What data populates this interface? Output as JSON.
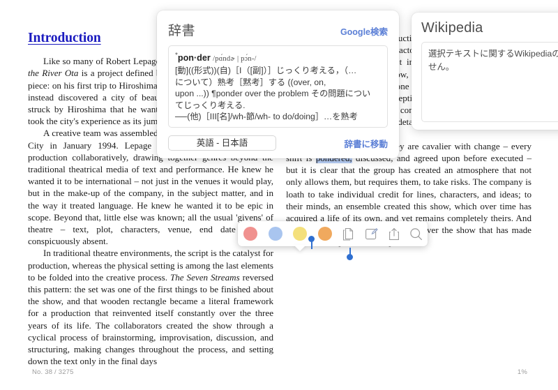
{
  "reader": {
    "chapter_title": "Introduction",
    "left_column": {
      "paragraphs": [
        "Like so many of Robert Lepage's works, The Seven Streams of the River Ota is a project defined by the journey that inspired the piece: on his first trip to Hiroshima, expecting devastation, Lepage instead discovered a city of beauty and sensuality. He was so struck by Hiroshima that he wanted to create a production that took the city's experience as its jumping-off point.",
        "A creative team was assembled for a first workshop in Quebec City in January 1994. Lepage challenged them to create a production collaboratively, drawing together genres beyond the traditional theatrical media of text and performance. He knew he wanted it to be international – not just in the venues it would play, but in the make-up of the company, in the subject matter, and in the way it treated language. He knew he wanted it to be epic in scope. Beyond that, little else was known; all the usual 'givens' of theatre – text, plot, characters, venue, end date – were conspicuously absent.",
        "In traditional theatre environments, the script is the catalyst for production, whereas the physical setting is among the last elements to be folded into the creative process. The Seven Streams reversed this pattern: the set was one of the first things to be finished about the show, and that wooden rectangle became a literal framework for a production that reinvented itself constantly over the three years of its life. The collaborators created the show through a cyclical process of brainstorming, improvisation, discussion, and structuring, making changes throughout the process, and setting down the text only in the final days"
      ]
    },
    "right_column": {
      "paragraphs": [
        "of rehearsal. While most productions settle considerably once the script has been handed to the actors, in this production the actors are the authors, and this fact informs both their extraordinary openness to changes in the show, and the uniquely alive quality of their performance. As someone who has observed The Seven Streams' progress since its inception, I never stop being surprised by the freedom with which the company plays with the production, calling into question small details and large elements of the process.",
        "This is not to say that they are cavalier with change – every shift is pondered, discussed, and agreed upon before executed – but it is clear that the group has created an atmosphere that not only allows them, but requires them, to take risks. The company is loath to take individual credit for lines, characters, and ideas; to their minds, an ensemble created this show, which over time has acquired a life of its own, and yet remains completely theirs. And it is their ability to give up control over the show that has made their ownership of it so complete."
      ],
      "selected_text": "pondered,"
    }
  },
  "dictionary_card": {
    "title": "辞書",
    "google_search_label": "Google検索",
    "entry": {
      "star": "*",
      "headword": "pon·der",
      "pronunciation": "/pɑ́ndɚ | pɔ́n-/",
      "definition_line_1": "[動]((形式))(自)［I（[副]）］じっくり考える，（…",
      "definition_line_2": "について）熟考［黙考］する ((over, on,",
      "definition_line_3": "upon ...)) ¶ponder over the problem その問題につい",
      "definition_line_4": "てじっくり考える.",
      "definition_line_5": "──(他)［III[名]/wh-節/wh- to do/doing］…を熟考"
    },
    "language_button_label": "英語 - 日本語",
    "go_to_dictionary_label": "辞書に移動"
  },
  "wikipedia_card": {
    "title": "Wikipedia",
    "body_line_1": "選択テキストに関するWikipediaの",
    "body_line_2": "せん。"
  },
  "selection_toolbar": {
    "swatches": [
      {
        "name": "highlight-pink",
        "color": "#f0918f"
      },
      {
        "name": "highlight-blue",
        "color": "#a9c5ef"
      },
      {
        "name": "highlight-yellow",
        "color": "#f4e07c"
      },
      {
        "name": "highlight-orange",
        "color": "#f0a95e"
      }
    ],
    "actions": [
      {
        "name": "copy-icon",
        "label": "コピー"
      },
      {
        "name": "note-icon",
        "label": "ノート"
      },
      {
        "name": "share-icon",
        "label": "共有"
      },
      {
        "name": "search-icon",
        "label": "検索"
      }
    ]
  },
  "footer": {
    "location": "No. 38 / 3275",
    "progress": "1%"
  },
  "colors": {
    "link_blue": "#5b7fd6",
    "heading_blue": "#1b1bbf",
    "selection_blue": "#b7cdf5",
    "handle_blue": "#2f6fd0"
  }
}
